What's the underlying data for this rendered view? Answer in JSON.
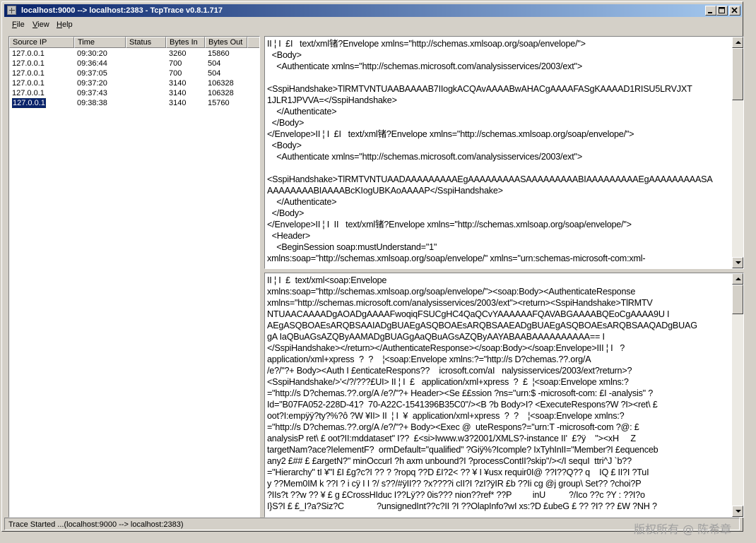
{
  "window": {
    "title": "localhost:9000 --> localhost:2383 - TcpTrace v0.8.1.717"
  },
  "menu": {
    "items": [
      "File",
      "View",
      "Help"
    ]
  },
  "connections": {
    "columns": [
      "Source IP",
      "Time",
      "Status",
      "Bytes In",
      "Bytes Out"
    ],
    "rows": [
      {
        "ip": "127.0.0.1",
        "time": "09:30:20",
        "status": "",
        "bytes_in": "3260",
        "bytes_out": "15860"
      },
      {
        "ip": "127.0.0.1",
        "time": "09:36:44",
        "status": "",
        "bytes_in": "700",
        "bytes_out": "504"
      },
      {
        "ip": "127.0.0.1",
        "time": "09:37:05",
        "status": "",
        "bytes_in": "700",
        "bytes_out": "504"
      },
      {
        "ip": "127.0.0.1",
        "time": "09:37:20",
        "status": "",
        "bytes_in": "3140",
        "bytes_out": "106328"
      },
      {
        "ip": "127.0.0.1",
        "time": "09:37:43",
        "status": "",
        "bytes_in": "3140",
        "bytes_out": "106328"
      },
      {
        "ip": "127.0.0.1",
        "time": "09:38:38",
        "status": "",
        "bytes_in": "3140",
        "bytes_out": "15760",
        "selected": true
      }
    ]
  },
  "request_lines": [
    "II ¦ I  £I   text/xml锗?Envelope xmlns=\"http://schemas.xmlsoap.org/soap/envelope/\">",
    "  <Body>",
    "    <Authenticate xmlns=\"http://schemas.microsoft.com/analysisservices/2003/ext\">",
    "",
    "<SspiHandshake>TlRMTVNTUAABAAAAB7IIogkACQAvAAAABwAHACgAAAAFASgKAAAAD1RISU5LRVJXT",
    "1JLR1JPVVA=</SspiHandshake>",
    "    </Authenticate>",
    "  </Body>",
    "</Envelope>II ¦ I  £I   text/xml锗?Envelope xmlns=\"http://schemas.xmlsoap.org/soap/envelope/\">",
    "  <Body>",
    "    <Authenticate xmlns=\"http://schemas.microsoft.com/analysisservices/2003/ext\">",
    "",
    "<SspiHandshake>TlRMTVNTUAADAAAAAAAAAEgAAAAAAAAASAAAAAAAAABIAAAAAAAAAEgAAAAAAAAASA",
    "AAAAAAAABIAAAABcKIogUBKAoAAAAP</SspiHandshake>",
    "    </Authenticate>",
    "  </Body>",
    "</Envelope>II ¦ I  II   text/xml锗?Envelope xmlns=\"http://schemas.xmlsoap.org/soap/envelope/\">",
    "  <Header>",
    "    <BeginSession soap:mustUnderstand=\"1\"",
    "xmlns:soap=\"http://schemas.xmlsoap.org/soap/envelope/\" xmlns=\"urn:schemas-microsoft-com:xml-"
  ],
  "response_lines": [
    "II ¦ I  £  text/xml<soap:Envelope",
    "xmlns:soap=\"http://schemas.xmlsoap.org/soap/envelope/\"><soap:Body><AuthenticateResponse",
    "xmlns=\"http://schemas.microsoft.com/analysisservices/2003/ext\"><return><SspiHandshake>TlRMTV",
    "NTUAACAAAADgAOADgAAAAFwoqiqFSUCgHC4QaQCvYAAAAAAFQAVABGAAAABQEoCgAAAA9U I",
    "AEgASQBOAEsARQBSAAIADgBUAEgASQBOAEsARQBSAAEADgBUAEgASQBOAEsARQBSAAQADgBUAG",
    "gA IaQBuAGsAZQByAAMADgBUAGgAaQBuAGsAZQByAAYABAABAAAAAAAAAA== I",
    "</SspiHandshake></return></AuthenticateResponse></soap:Body></soap:Envelope>III ¦ I   ?",
    "application/xml+xpress  ?  ?    ¦<soap:Envelope xmlns:?=\"http://s D?chemas.??.org/A",
    "/e?/\"?+ Body><Auth I £enticateRespons??    icrosoft.com/aI   nalysisservices/2003/ext?return>?",
    "<SspiHandshake/>'</?/???£UI> II ¦ I  £   application/xml+xpress  ?  £  ¦<soap:Envelope xmlns:?",
    "=\"http://s D?chemas.??.org/A /e?/\"?+ Header><Se ££ssion ?ns=\"urn:$ -microsoft-com: £I -analysis\" ?",
    "Id=\"B07FA052-228D-41?  70-A22C-1541396B35C0\"/><B ?b Body>I? <ExecuteRespons?W ?I><ret\\ £",
    "oot?I:empÿÿ?ty?%?ô ?W ¥II> II  ¦ I  ¥  application/xml+xpress  ?  ?    ¦<soap:Envelope xmlns:?",
    "=\"http://s D?chemas.??.org/A /e?/\"?+ Body><Exec @  uteRespons?=\"urn:T -microsoft-com ?@: £",
    "analysisP ret\\ £ oot?II:mddataset\" I??  £<si>Iwww.w3?2001/XMLS?-instance II'  £?ÿ    \"><xH     Z",
    "targetNam?ace?IelementF?  ormDefault=\"qualified\" ?Giÿ%?Icomple? IxTyhInII=\"Member?I £equenceb",
    "any2 £## £ £argetN?\" minOccurI ?h axm unbound?I ?processContII?skip\"/></I sequI  ttri^J `b??",
    "=\"Hierarchy\" tI ¥\"I £I £g?c?I ?? ? ?ropq ??D £I?2< ?? ¥ I ¥usx requir0I@ ??I??Q?? q    IQ £ II?I ?TuI",
    "y ??Mem0IM k ??I ? i cÿ I I ?/ s??/#ÿII?? ?x????i cII?I ?zI?ÿIR £b ??Ii cg @j group\\ Set?? ?choi?P",
    "?IIs?t ??w ?? ¥ £ g £CrossHIduc I??Lÿ?? 0is??? nion??ref* ??P         inU          ?/Ico ??c ?Y : ??I?o",
    "I}S?I £ £_I?a?Siz?C              ?unsignedInt??c?II ?I ??OlapInfo?wI xs:?D £ubeG £ ?? ?I? ?? £W ?NH ?"
  ],
  "status": {
    "text": "Trace Started ...(localhost:9000 --> localhost:2383)"
  },
  "watermark": "版权所有 @  陈希章"
}
